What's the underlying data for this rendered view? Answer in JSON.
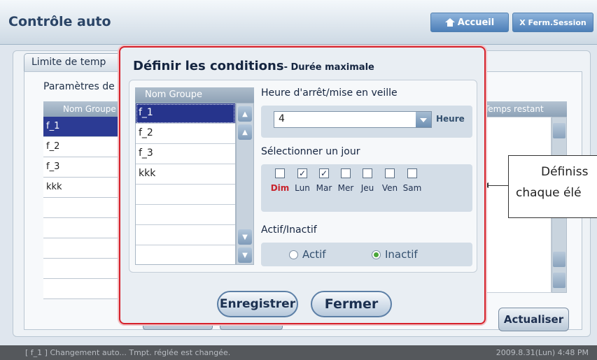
{
  "header": {
    "title": "Contrôle auto",
    "home_label": "Accueil",
    "logout_label": "X Ferm.Session"
  },
  "background": {
    "tab_label": "Limite de temp",
    "section_label": "Paramètres de",
    "col_group": "Nom Groupe",
    "col_remaining": "Temps restant",
    "rows": [
      "f_1",
      "f_2",
      "f_3",
      "kkk"
    ],
    "refresh_label": "Actualiser"
  },
  "callout": {
    "line1": "Définiss",
    "line2": "chaque élé"
  },
  "modal": {
    "title": "Définir les conditions",
    "subtitle": "- Durée maximale",
    "group_header": "Nom Groupe",
    "groups": [
      "f_1",
      "f_2",
      "f_3",
      "kkk",
      "",
      "",
      "",
      ""
    ],
    "selected_group": "f_1",
    "hour_label": "Heure d'arrêt/mise en veille",
    "hour_value": "4",
    "hour_unit": "Heure",
    "day_label": "Sélectionner un jour",
    "days": [
      {
        "label": "Dim",
        "checked": false
      },
      {
        "label": "Lun",
        "checked": true
      },
      {
        "label": "Mar",
        "checked": true
      },
      {
        "label": "Mer",
        "checked": false
      },
      {
        "label": "Jeu",
        "checked": false
      },
      {
        "label": "Ven",
        "checked": false
      },
      {
        "label": "Sam",
        "checked": false
      }
    ],
    "active_label": "Actif/Inactif",
    "active_option": "Actif",
    "inactive_option": "Inactif",
    "selected_state": "Inactif",
    "save_label": "Enregistrer",
    "close_label": "Fermer"
  },
  "status": {
    "message": "[ f_1 ] Changement auto... Tmpt. réglée est changée.",
    "datetime": "2009.8.31(Lun)  4:48 PM"
  },
  "colors": {
    "accent": "#26348c",
    "modal_border": "#d6202a",
    "sunday": "#c8232c",
    "radio_on": "#4aa63a"
  },
  "icons": {
    "home": "home-icon",
    "dropdown": "chevron-down-icon",
    "scroll_up": "arrow-up-icon",
    "scroll_down": "arrow-down-icon",
    "scroll_top": "double-arrow-up-icon",
    "scroll_bottom": "double-arrow-down-icon"
  }
}
